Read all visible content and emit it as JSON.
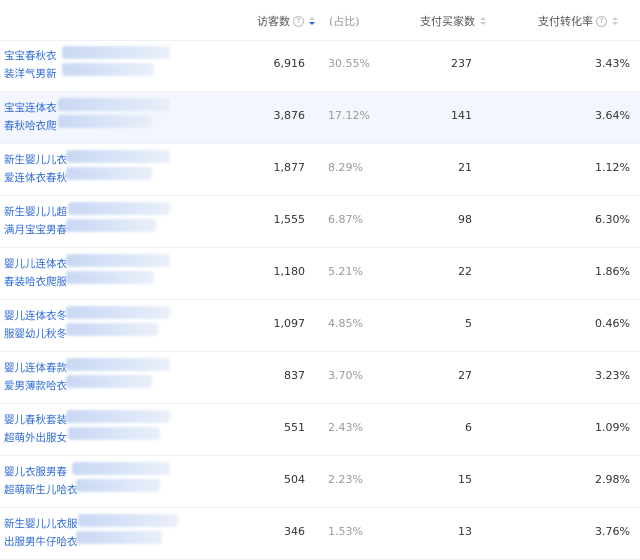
{
  "header": {
    "visitors": "访客数",
    "share": "(占比)",
    "buyers": "支付买家数",
    "rate": "支付转化率"
  },
  "rows": [
    {
      "line1": "宝宝春秋衣",
      "line2": "装洋气男新",
      "visitors": "6,916",
      "share": "30.55%",
      "buyers": "237",
      "rate": "3.43%"
    },
    {
      "line1": "宝宝连体衣",
      "line2": "春秋哈衣爬",
      "visitors": "3,876",
      "share": "17.12%",
      "buyers": "141",
      "rate": "3.64%"
    },
    {
      "line1": "新生婴儿儿衣",
      "line2": "爱连体衣春秋",
      "visitors": "1,877",
      "share": "8.29%",
      "buyers": "21",
      "rate": "1.12%"
    },
    {
      "line1": "新生婴儿儿超",
      "line2": "满月宝宝男春",
      "visitors": "1,555",
      "share": "6.87%",
      "buyers": "98",
      "rate": "6.30%"
    },
    {
      "line1": "婴儿儿连体衣",
      "line2": "春装哈衣爬服",
      "visitors": "1,180",
      "share": "5.21%",
      "buyers": "22",
      "rate": "1.86%"
    },
    {
      "line1": "婴儿连体衣冬",
      "line2": "服婴幼儿秋冬",
      "visitors": "1,097",
      "share": "4.85%",
      "buyers": "5",
      "rate": "0.46%"
    },
    {
      "line1": "婴儿连体春款",
      "line2": "爱男薄款哈衣",
      "visitors": "837",
      "share": "3.70%",
      "buyers": "27",
      "rate": "3.23%"
    },
    {
      "line1": "婴儿春秋套装",
      "line2": "超萌外出服女",
      "visitors": "551",
      "share": "2.43%",
      "buyers": "6",
      "rate": "1.09%"
    },
    {
      "line1": "婴儿衣服男春",
      "line2": "超萌新生儿哈衣",
      "visitors": "504",
      "share": "2.23%",
      "buyers": "15",
      "rate": "2.98%"
    },
    {
      "line1": "新生婴儿儿衣服",
      "line2": "出服男牛仔哈衣",
      "visitors": "346",
      "share": "1.53%",
      "buyers": "13",
      "rate": "3.76%"
    }
  ]
}
